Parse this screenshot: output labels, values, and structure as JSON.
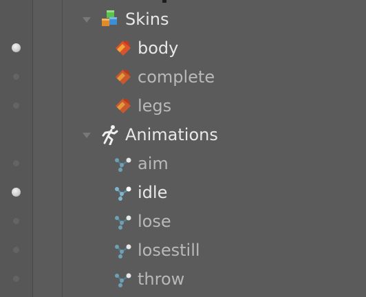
{
  "tree": {
    "skins_folder": {
      "label": "Skins",
      "icon": "skins-folder-icon"
    },
    "skins": [
      {
        "label": "body",
        "visible": true
      },
      {
        "label": "complete",
        "visible": false
      },
      {
        "label": "legs",
        "visible": false
      }
    ],
    "animations_folder": {
      "label": "Animations",
      "icon": "running-figure-icon"
    },
    "animations": [
      {
        "label": "aim",
        "visible": false
      },
      {
        "label": "idle",
        "visible": true
      },
      {
        "label": "lose",
        "visible": false
      },
      {
        "label": "losestill",
        "visible": false
      },
      {
        "label": "throw",
        "visible": false
      }
    ]
  },
  "colors": {
    "background": "#5b5b5b",
    "text": "#e8e8e8",
    "text_dim": "#b9b9b9",
    "skin_icon": "#e0612e",
    "animation_icon": "#6fa0b3"
  }
}
